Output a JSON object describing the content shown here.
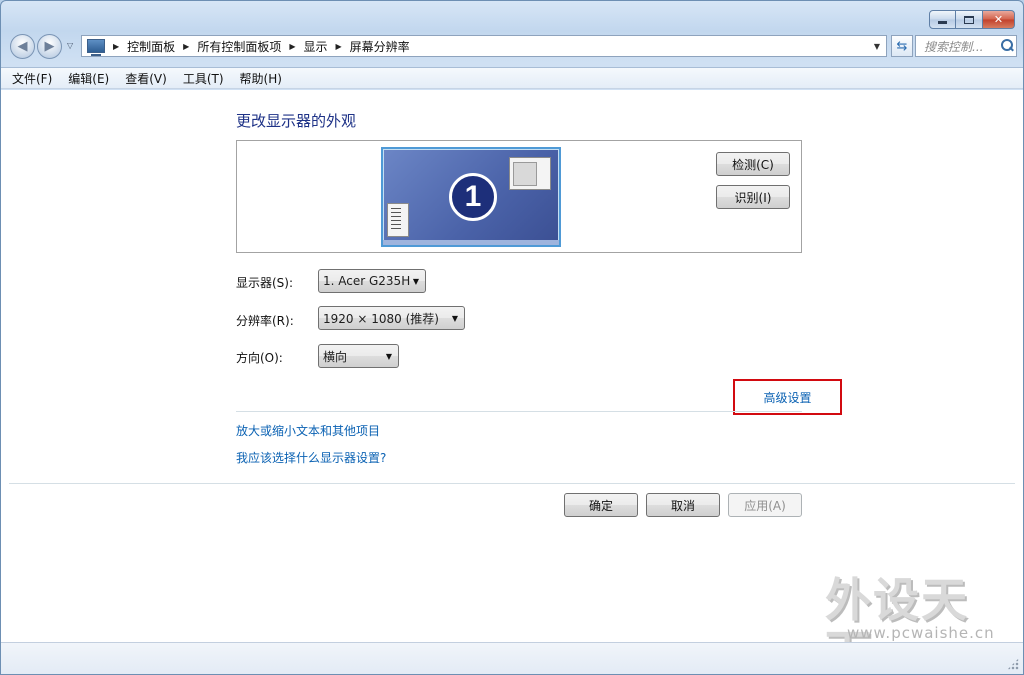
{
  "window": {
    "caption": {
      "minimize_icon": "minimize-icon",
      "maximize_icon": "maximize-icon",
      "close_icon": "close-icon"
    }
  },
  "nav": {
    "back_icon": "back-arrow-icon",
    "forward_icon": "forward-arrow-icon",
    "breadcrumb": [
      "控制面板",
      "所有控制面板项",
      "显示",
      "屏幕分辨率"
    ],
    "search_placeholder": "搜索控制..."
  },
  "menu": [
    "文件(F)",
    "编辑(E)",
    "查看(V)",
    "工具(T)",
    "帮助(H)"
  ],
  "main": {
    "heading": "更改显示器的外观",
    "monitor_number": "1",
    "detect_label": "检测(C)",
    "identify_label": "识别(I)",
    "display_label": "显示器(S):",
    "display_value": "1. Acer G235H",
    "resolution_label": "分辨率(R):",
    "resolution_value": "1920 × 1080 (推荐)",
    "orientation_label": "方向(O):",
    "orientation_value": "横向",
    "advanced_link": "高级设置",
    "link_text_size": "放大或缩小文本和其他项目",
    "link_which_settings": "我应该选择什么显示器设置?",
    "ok_label": "确定",
    "cancel_label": "取消",
    "apply_label": "应用(A)"
  },
  "watermark": {
    "text": "外设天下",
    "url": "www.pcwaishe.cn"
  },
  "colors": {
    "link": "#0b62b3",
    "heading": "#1e3287",
    "highlight_box": "#d20a10"
  }
}
